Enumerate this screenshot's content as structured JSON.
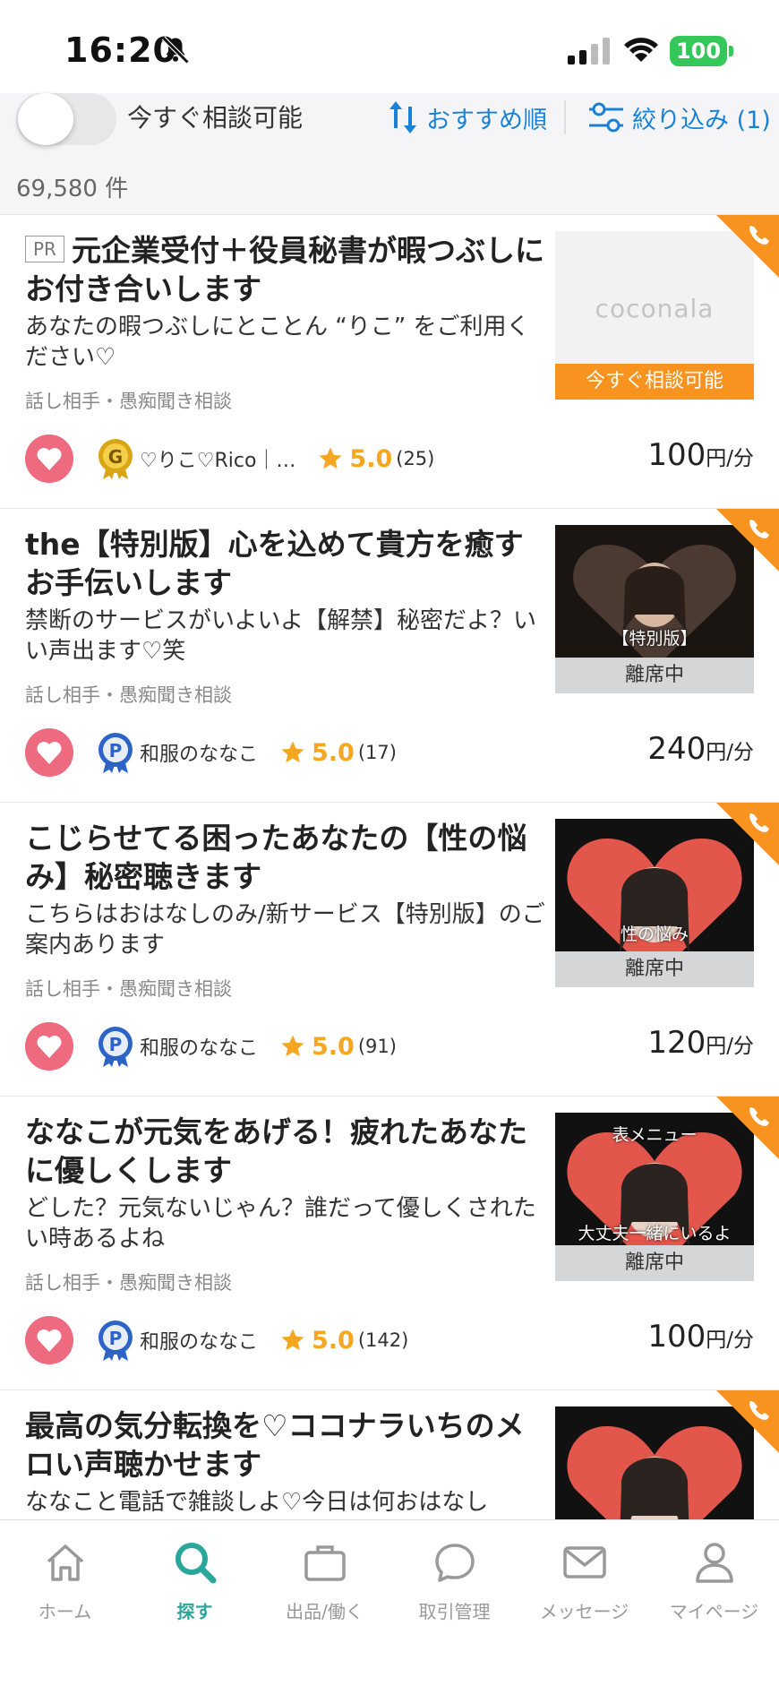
{
  "status_bar": {
    "time": "16:20",
    "battery": "100"
  },
  "filter_bar": {
    "available_label": "今すぐ相談可能",
    "sort_label": "おすすめ順",
    "filter_label": "絞り込み (1)",
    "result_count": "69,580 件"
  },
  "listings": [
    {
      "pr": "PR",
      "title": "元企業受付＋役員秘書が暇つぶしにお付き合いします",
      "description": "あなたの暇つぶしにとことん “りこ” をご利用ください♡",
      "category": "話し相手・愚痴聞き相談",
      "seller": "♡りこ♡Rico｜…",
      "rank": "G",
      "rating": "5.0",
      "reviews": "(25)",
      "price": "100",
      "price_unit": "円/分",
      "thumb_text": "coconala",
      "status": "今すぐ相談可能",
      "favorited": true
    },
    {
      "title": "the【特別版】心を込めて貴方を癒すお手伝いします",
      "description": "禁断のサービスがいよいよ【解禁】秘密だよ？いい声出ます♡笑",
      "category": "話し相手・愚痴聞き相談",
      "seller": "和服のななこ",
      "rank": "P",
      "rating": "5.0",
      "reviews": "(17)",
      "price": "240",
      "price_unit": "円/分",
      "thumb_text": "【特別版】",
      "status": "離席中",
      "favorited": true
    },
    {
      "title": "こじらせてる困ったあなたの【性の悩み】秘密聴きます",
      "description": "こちらはおはなしのみ/新サービス【特別版】のご案内あります",
      "category": "話し相手・愚痴聞き相談",
      "seller": "和服のななこ",
      "rank": "P",
      "rating": "5.0",
      "reviews": "(91)",
      "price": "120",
      "price_unit": "円/分",
      "thumb_text": "性の悩み",
      "status": "離席中",
      "favorited": true
    },
    {
      "title": "ななこが元気をあげる！疲れたあなたに優しくします",
      "description": "どした？元気ないじゃん？誰だって優しくされたい時あるよね",
      "category": "話し相手・愚痴聞き相談",
      "seller": "和服のななこ",
      "rank": "P",
      "rating": "5.0",
      "reviews": "(142)",
      "price": "100",
      "price_unit": "円/分",
      "thumb_text_top": "表メニュー",
      "thumb_text": "大丈夫一緒にいるよ",
      "status": "離席中",
      "favorited": true
    },
    {
      "title": "最高の気分転換を♡ココナラいちのメロい声聴かせます",
      "description": "ななこと電話で雑談しよ♡今日は何おはなし"
    }
  ],
  "tabbar": {
    "home": "ホーム",
    "search": "探す",
    "sell": "出品/働く",
    "transactions": "取引管理",
    "messages": "メッセージ",
    "mypage": "マイページ"
  },
  "colors": {
    "accent_blue": "#1a82d6",
    "accent_orange": "#f7931e",
    "heart_pink": "#ee6a7e",
    "active_tab_teal": "#2ba69b",
    "star_gold": "#f5a623"
  }
}
